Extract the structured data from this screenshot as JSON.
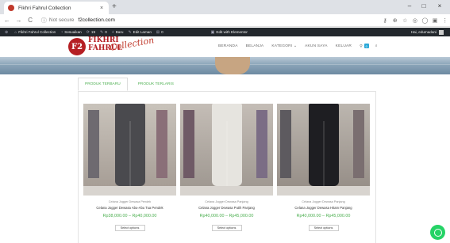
{
  "browser": {
    "tab_title": "Fikhri Fahrul Collection",
    "tab_close": "×",
    "new_tab": "+",
    "window_controls": {
      "minimize": "–",
      "maximize": "□",
      "close": "×"
    },
    "nav": {
      "back": "←",
      "forward": "→",
      "reload": "C"
    },
    "omnibox": {
      "info_icon": "ⓘ",
      "security": "Not secure",
      "url": "f2collection.com"
    },
    "toolbar_icons": [
      "key-icon",
      "zoom-icon",
      "star-icon",
      "extension-icon",
      "opera-icon",
      "menu-icon"
    ]
  },
  "admin_bar": {
    "items": [
      {
        "icon": "⊕",
        "label": ""
      },
      {
        "icon": "⌂",
        "label": "Fikhri Fahrul Collection"
      },
      {
        "icon": "◔",
        "label": "Sesuaikan"
      },
      {
        "icon": "⟳",
        "label": "19"
      },
      {
        "icon": "✎",
        "label": "0"
      },
      {
        "icon": "+",
        "label": "Baru"
      },
      {
        "icon": "✎",
        "label": "Edit Laman"
      },
      {
        "icon": "⊞",
        "label": "0"
      },
      {
        "icon": "▣",
        "label": "Edit with Elementor"
      }
    ],
    "greeting": "Hai, edumadani"
  },
  "header": {
    "logo_badge": "F2",
    "logo_line1": "FIKHRI",
    "logo_line2": "FAHRUL",
    "logo_script": "Collection",
    "nav": [
      "BERANDA",
      "BELANJA",
      "KATEGORI ⌄",
      "AKUN SAYA",
      "KELUAR"
    ],
    "cart_icon": "⚲",
    "cart_count": "0",
    "search_icon": "⌕"
  },
  "tabs": [
    "PRODUK TERBARU",
    "PRODUK TERLARIS"
  ],
  "products": [
    {
      "category": "Celana Jogger Dewasa Pendek",
      "name": "Celana Jogger Dewasa Abu-Abu Tua Pendek",
      "price": "Rp38,000.00 – Rp40,000.00",
      "button": "Select options"
    },
    {
      "category": "Celana Jogger Dewasa Panjang",
      "name": "Celana Jogger Dewasa Putih Panjang",
      "price": "Rp40,000.00 – Rp45,000.00",
      "button": "Select options"
    },
    {
      "category": "Celana Jogger Dewasa Panjang",
      "name": "Celana Jogger Dewasa Hitam Panjang",
      "price": "Rp40,000.00 – Rp45,000.00",
      "button": "Select options"
    }
  ],
  "colors": {
    "accent_green": "#4caf50",
    "brand_red": "#b51f24",
    "whatsapp": "#25d366",
    "admin_bar": "#23282d"
  },
  "whatsapp_icon": "whatsapp-icon"
}
